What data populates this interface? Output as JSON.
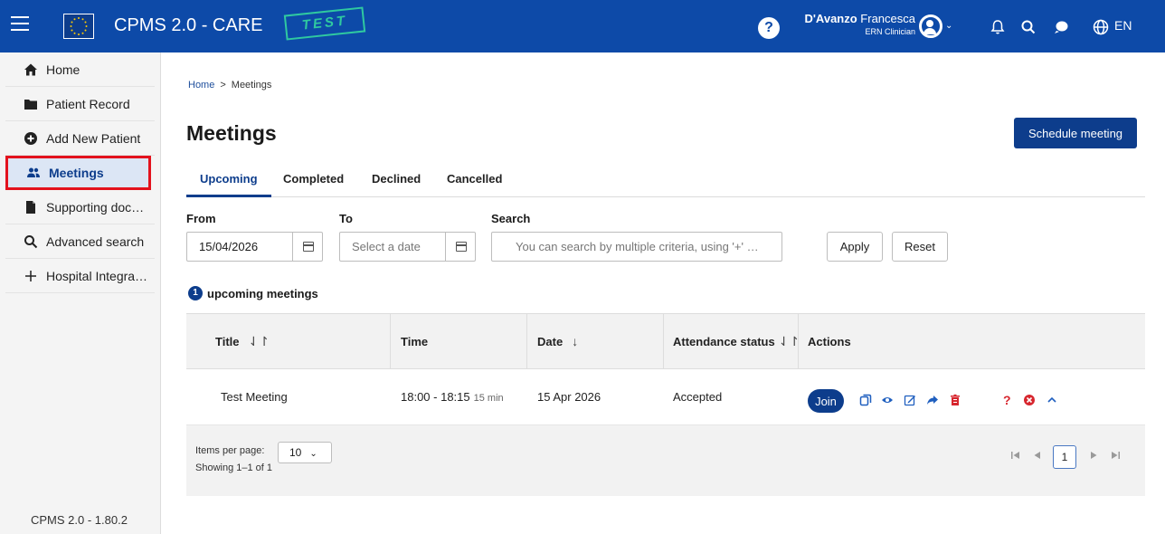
{
  "header": {
    "app_title": "CPMS 2.0 - CARE",
    "test_stamp": "TEST",
    "user_name_bold": "D'Avanzo",
    "user_name_rest": " Francesca",
    "user_role": "ERN Clinician",
    "language": "EN",
    "bar_color": "#0d4aa8"
  },
  "sidebar": {
    "items": [
      {
        "label": "Home",
        "icon": "home-icon"
      },
      {
        "label": "Patient Record",
        "icon": "folder-icon"
      },
      {
        "label": "Add New Patient",
        "icon": "add-circle-icon"
      },
      {
        "label": "Meetings",
        "icon": "people-icon"
      },
      {
        "label": "Supporting doc…",
        "icon": "document-icon"
      },
      {
        "label": "Advanced search",
        "icon": "search-icon"
      },
      {
        "label": "Hospital Integra…",
        "icon": "plus-icon"
      }
    ],
    "active": "Meetings",
    "version": "CPMS 2.0 - 1.80.2"
  },
  "breadcrumb": {
    "home": "Home",
    "current": "Meetings"
  },
  "page": {
    "title": "Meetings",
    "schedule_label": "Schedule meeting"
  },
  "tabs": [
    {
      "label": "Upcoming",
      "active": true
    },
    {
      "label": "Completed"
    },
    {
      "label": "Declined"
    },
    {
      "label": "Cancelled"
    }
  ],
  "filters": {
    "from_label": "From",
    "from_value": "15/04/2026",
    "to_label": "To",
    "to_placeholder": "Select a date",
    "search_label": "Search",
    "search_placeholder": "You can search by multiple criteria, using '+' …",
    "apply_label": "Apply",
    "reset_label": "Reset"
  },
  "summary": {
    "count": "1",
    "text": "upcoming meetings"
  },
  "table": {
    "columns": [
      "Title",
      "Time",
      "Date",
      "Attendance status",
      "Actions"
    ],
    "rows": [
      {
        "title": "Test Meeting",
        "time": "18:00 - 18:15",
        "duration": "15 min",
        "date": "15 Apr 2026",
        "status": "Accepted",
        "join_label": "Join"
      }
    ]
  },
  "pagination": {
    "items_per_page_label": "Items per page:",
    "items_per_page_value": "10",
    "showing": "Showing 1–1 of 1",
    "current_page": "1"
  }
}
